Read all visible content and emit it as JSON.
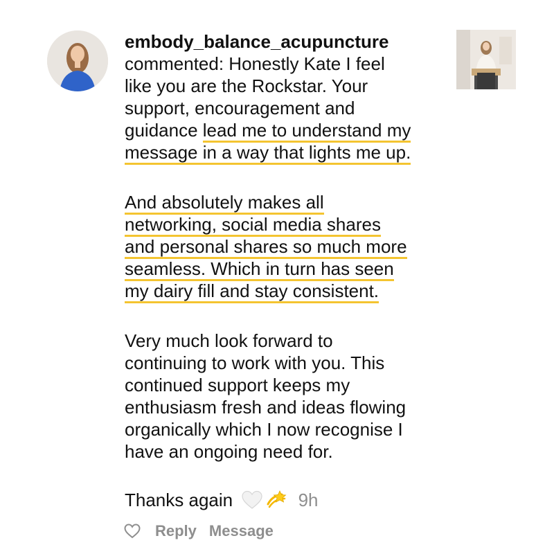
{
  "comment": {
    "username": "embody_balance_acupuncture",
    "intro_plain": "commented: Honestly Kate I feel",
    "lines_p1": [
      {
        "plain": "like you are the Rockstar. Your",
        "hl": ""
      },
      {
        "plain": "support, encouragement and",
        "hl": ""
      },
      {
        "plain": "guidance ",
        "hl": "lead me to understand my"
      },
      {
        "plain": "",
        "hl": "message in a way that lights me up."
      }
    ],
    "lines_p2": [
      "And absolutely makes all",
      "networking, social media shares",
      "and personal shares so much more",
      "seamless. Which in turn has seen",
      "my dairy fill and stay consistent."
    ],
    "lines_p3": [
      "Very much look forward to",
      "continuing to work with you.  This",
      "continued support keeps my",
      "enthusiasm fresh and ideas flowing",
      "organically which I now recognise I",
      "have an ongoing need for."
    ],
    "thanks_text": "Thanks again",
    "emojis": [
      "white-heart-icon",
      "dizzy-icon"
    ],
    "time": "9h"
  },
  "actions": {
    "like_icon": "heart-outline-icon",
    "reply_label": "Reply",
    "message_label": "Message"
  },
  "colors": {
    "highlight": "#f4c430",
    "muted": "#8e8e8e",
    "text": "#111111"
  }
}
